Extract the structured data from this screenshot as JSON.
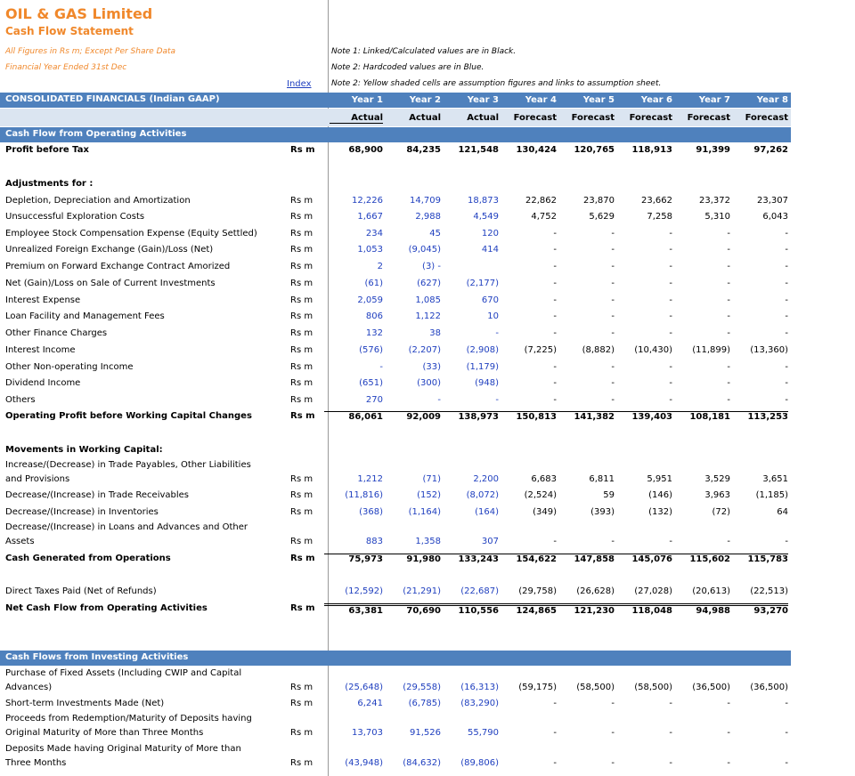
{
  "header": {
    "company": "OIL & GAS Limited",
    "statement": "Cash Flow Statement",
    "figures_note": "All Figures in Rs m; Except Per Share Data",
    "fy_note": "Financial Year Ended 31st Dec",
    "index_link": "Index"
  },
  "notes": [
    "Note 1: Linked/Calculated values are in Black.",
    "Note 2: Hardcoded values are in Blue.",
    "Note 2: Yellow shaded cells are assumption figures and links to assumption sheet."
  ],
  "table_header": {
    "title": "CONSOLIDATED FINANCIALS (Indian GAAP)",
    "years": [
      "Year 1",
      "Year 2",
      "Year 3",
      "Year 4",
      "Year 5",
      "Year 6",
      "Year 7",
      "Year 8"
    ],
    "types": [
      "Actual",
      "Actual",
      "Actual",
      "Forecast",
      "Forecast",
      "Forecast",
      "Forecast",
      "Forecast"
    ]
  },
  "section_operating": "Cash Flow from Operating Activities",
  "section_investing": "Cash Flows from Investing Activities",
  "unit": "Rs m",
  "rows": [
    {
      "id": "pbt",
      "label": "Profit before Tax",
      "unit": "Rs m",
      "bold": true,
      "values": [
        "68,900",
        "84,235",
        "121,548",
        "130,424",
        "120,765",
        "118,913",
        "91,399",
        "97,262"
      ]
    },
    {
      "id": "adj",
      "label": "Adjustments for :",
      "unit": "",
      "bold": true,
      "values": []
    },
    {
      "id": "dda",
      "label": "Depletion, Depreciation and Amortization",
      "unit": "Rs m",
      "values": [
        "12,226",
        "14,709",
        "18,873",
        "22,862",
        "23,870",
        "23,662",
        "23,372",
        "23,307"
      ]
    },
    {
      "id": "uec",
      "label": "Unsuccessful Exploration Costs",
      "unit": "Rs m",
      "values": [
        "1,667",
        "2,988",
        "4,549",
        "4,752",
        "5,629",
        "7,258",
        "5,310",
        "6,043"
      ]
    },
    {
      "id": "esc",
      "label": "Employee Stock Compensation Expense (Equity Settled)",
      "unit": "Rs m",
      "values": [
        "234",
        "45",
        "120",
        "-",
        "-",
        "-",
        "-",
        "-"
      ]
    },
    {
      "id": "ufx",
      "label": "Unrealized Foreign Exchange (Gain)/Loss (Net)",
      "unit": "Rs m",
      "values": [
        "1,053",
        "(9,045)",
        "414",
        "-",
        "-",
        "-",
        "-",
        "-"
      ]
    },
    {
      "id": "pfc",
      "label": "Premium on Forward Exchange Contract Amorized",
      "unit": "Rs m",
      "values": [
        "2",
        "(3) -",
        "",
        "-",
        "-",
        "-",
        "-",
        "-"
      ]
    },
    {
      "id": "ngs",
      "label": "Net (Gain)/Loss on Sale of Current Investments",
      "unit": "Rs m",
      "values": [
        "(61)",
        "(627)",
        "(2,177)",
        "-",
        "-",
        "-",
        "-",
        "-"
      ]
    },
    {
      "id": "iex",
      "label": "Interest Expense",
      "unit": "Rs m",
      "values": [
        "2,059",
        "1,085",
        "670",
        "-",
        "-",
        "-",
        "-",
        "-"
      ]
    },
    {
      "id": "lfm",
      "label": "Loan Facility and Management Fees",
      "unit": "Rs m",
      "values": [
        "806",
        "1,122",
        "10",
        "-",
        "-",
        "-",
        "-",
        "-"
      ]
    },
    {
      "id": "ofc",
      "label": "Other Finance Charges",
      "unit": "Rs m",
      "values": [
        "132",
        "38",
        "-",
        "-",
        "-",
        "-",
        "-",
        "-"
      ]
    },
    {
      "id": "iin",
      "label": "Interest Income",
      "unit": "Rs m",
      "values": [
        "(576)",
        "(2,207)",
        "(2,908)",
        "(7,225)",
        "(8,882)",
        "(10,430)",
        "(11,899)",
        "(13,360)"
      ]
    },
    {
      "id": "oni",
      "label": "Other Non-operating Income",
      "unit": "Rs m",
      "values": [
        "-",
        "(33)",
        "(1,179)",
        "-",
        "-",
        "-",
        "-",
        "-"
      ]
    },
    {
      "id": "div",
      "label": "Dividend Income",
      "unit": "Rs m",
      "values": [
        "(651)",
        "(300)",
        "(948)",
        "-",
        "-",
        "-",
        "-",
        "-"
      ]
    },
    {
      "id": "oth",
      "label": "Others",
      "unit": "Rs m",
      "values": [
        "270",
        "-",
        "-",
        "-",
        "-",
        "-",
        "-",
        "-"
      ]
    },
    {
      "id": "opw",
      "label": "Operating Profit before Working Capital Changes",
      "unit": "Rs m",
      "bold": true,
      "values": [
        "86,061",
        "92,009",
        "138,973",
        "150,813",
        "141,382",
        "139,403",
        "108,181",
        "113,253"
      ]
    },
    {
      "id": "mwc",
      "label": "Movements in Working Capital:",
      "unit": "",
      "bold": true,
      "values": []
    },
    {
      "id": "tpy",
      "label2": "Increase/(Decrease) in Trade Payables, Other Liabilities",
      "label": "and Provisions",
      "unit": "Rs m",
      "values": [
        "1,212",
        "(71)",
        "2,200",
        "6,683",
        "6,811",
        "5,951",
        "3,529",
        "3,651"
      ]
    },
    {
      "id": "trc",
      "label": "Decrease/(Increase) in Trade Receivables",
      "unit": "Rs m",
      "values": [
        "(11,816)",
        "(152)",
        "(8,072)",
        "(2,524)",
        "59",
        "(146)",
        "3,963",
        "(1,185)"
      ]
    },
    {
      "id": "inv",
      "label": "Decrease/(Increase) in Inventories",
      "unit": "Rs m",
      "values": [
        "(368)",
        "(1,164)",
        "(164)",
        "(349)",
        "(393)",
        "(132)",
        "(72)",
        "64"
      ]
    },
    {
      "id": "lna",
      "label2": "Decrease/(Increase) in Loans and Advances and Other",
      "label": "Assets",
      "unit": "Rs m",
      "values": [
        "883",
        "1,358",
        "307",
        "-",
        "-",
        "-",
        "-",
        "-"
      ]
    },
    {
      "id": "cgo",
      "label": "Cash Generated from Operations",
      "unit": "Rs m",
      "bold": true,
      "values": [
        "75,973",
        "91,980",
        "133,243",
        "154,622",
        "147,858",
        "145,076",
        "115,602",
        "115,783"
      ]
    },
    {
      "id": "dtp",
      "label": "Direct Taxes Paid (Net of Refunds)",
      "unit": "",
      "values": [
        "(12,592)",
        "(21,291)",
        "(22,687)",
        "(29,758)",
        "(26,628)",
        "(27,028)",
        "(20,613)",
        "(22,513)"
      ]
    },
    {
      "id": "ncf",
      "label": "Net Cash Flow from Operating Activities",
      "unit": "Rs m",
      "bold": true,
      "values": [
        "63,381",
        "70,690",
        "110,556",
        "124,865",
        "121,230",
        "118,048",
        "94,988",
        "93,270"
      ]
    },
    {
      "id": "pfa",
      "label2": "Purchase of Fixed Assets (Including CWIP and Capital",
      "label": "Advances)",
      "unit": "Rs m",
      "values": [
        "(25,648)",
        "(29,558)",
        "(16,313)",
        "(59,175)",
        "(58,500)",
        "(58,500)",
        "(36,500)",
        "(36,500)"
      ]
    },
    {
      "id": "sti",
      "label": "Short-term Investments Made (Net)",
      "unit": "Rs m",
      "values": [
        "6,241",
        "(6,785)",
        "(83,290)",
        "-",
        "-",
        "-",
        "-",
        "-"
      ]
    },
    {
      "id": "prd",
      "label2": "Proceeds from Redemption/Maturity of Deposits having",
      "label": "Original Maturity of More than Three Months",
      "unit": "Rs m",
      "values": [
        "13,703",
        "91,526",
        "55,790",
        "-",
        "-",
        "-",
        "-",
        "-"
      ]
    },
    {
      "id": "dep",
      "label2": "Deposits Made having Original Maturity of More than",
      "label": "Three Months",
      "unit": "Rs m",
      "values": [
        "(43,948)",
        "(84,632)",
        "(89,806)",
        "-",
        "-",
        "-",
        "-",
        "-"
      ]
    }
  ]
}
